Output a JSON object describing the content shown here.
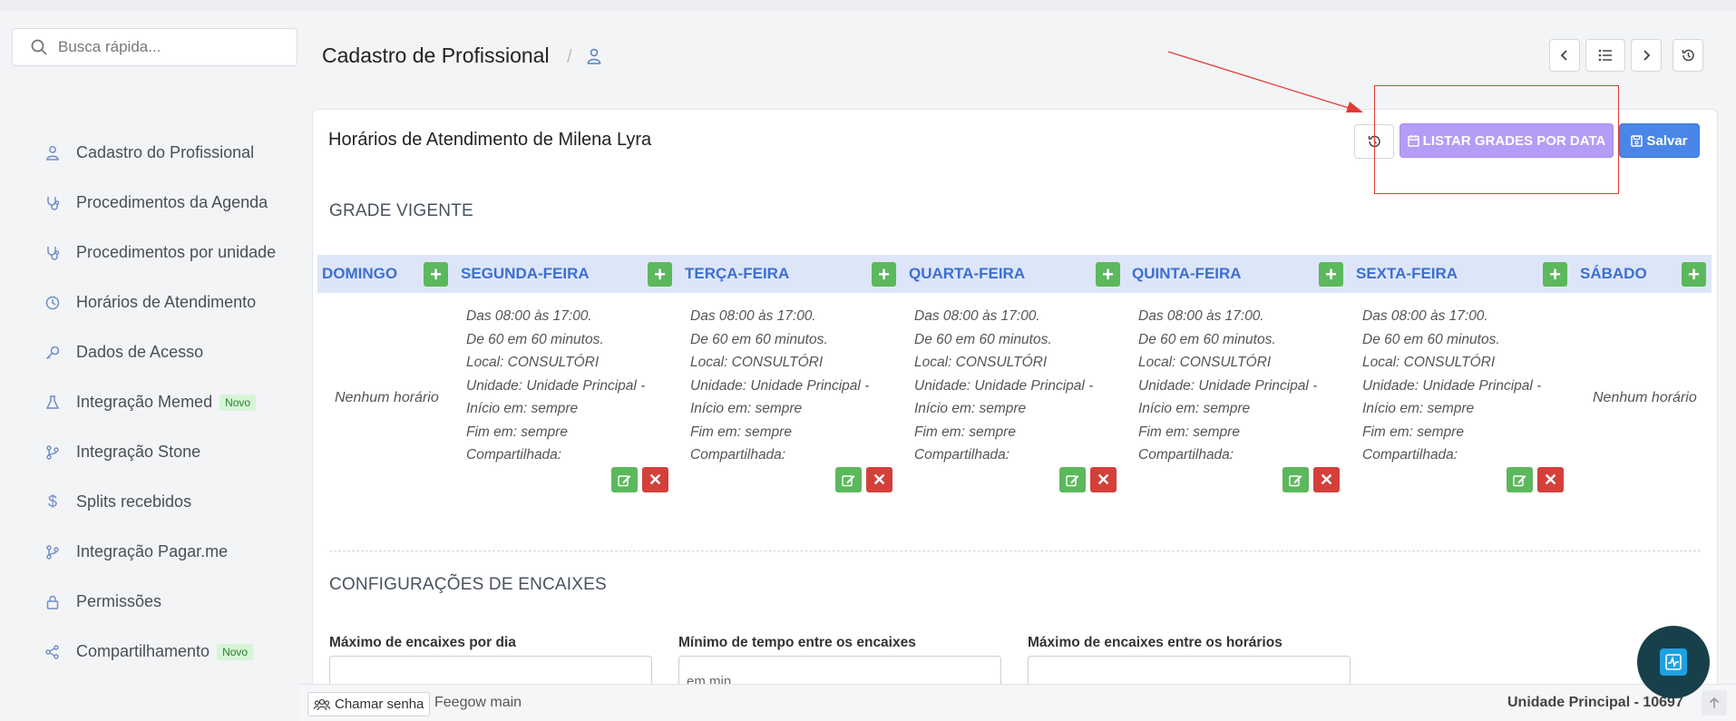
{
  "search": {
    "placeholder": "Busca rápida..."
  },
  "sidebar": {
    "items": [
      {
        "label": "Cadastro do Profissional",
        "icon": "user-doctor-icon"
      },
      {
        "label": "Procedimentos da Agenda",
        "icon": "stethoscope-icon"
      },
      {
        "label": "Procedimentos por unidade",
        "icon": "stethoscope-icon"
      },
      {
        "label": "Horários de Atendimento",
        "icon": "clock-icon"
      },
      {
        "label": "Dados de Acesso",
        "icon": "key-icon"
      },
      {
        "label": "Integração Memed",
        "icon": "flask-icon",
        "badge": "Novo"
      },
      {
        "label": "Integração Stone",
        "icon": "branch-icon"
      },
      {
        "label": "Splits recebidos",
        "icon": "dollar-icon"
      },
      {
        "label": "Integração Pagar.me",
        "icon": "branch-icon"
      },
      {
        "label": "Permissões",
        "icon": "lock-icon"
      },
      {
        "label": "Compartilhamento",
        "icon": "share-icon",
        "badge": "Novo"
      }
    ]
  },
  "header": {
    "title": "Cadastro de Profissional",
    "separator": "/"
  },
  "card": {
    "title": "Horários de Atendimento de Milena Lyra",
    "list_button": "LISTAR GRADES POR DATA",
    "save_button": "Salvar"
  },
  "grade": {
    "title": "GRADE VIGENTE",
    "days": [
      {
        "label": "DOMINGO",
        "empty": true,
        "empty_text": "Nenhum horário"
      },
      {
        "label": "SEGUNDA-FEIRA",
        "empty": false
      },
      {
        "label": "TERÇA-FEIRA",
        "empty": false
      },
      {
        "label": "QUARTA-FEIRA",
        "empty": false
      },
      {
        "label": "QUINTA-FEIRA",
        "empty": false
      },
      {
        "label": "SEXTA-FEIRA",
        "empty": false
      },
      {
        "label": "SÁBADO",
        "empty": true,
        "empty_text": "Nenhum horário"
      }
    ],
    "slot": {
      "hours": "Das 08:00 às 17:00.",
      "interval": "De 60 em 60 minutos.",
      "local": "Local: CONSULTÓRI",
      "unit": "Unidade: Unidade Principal -",
      "start": "Início em: sempre",
      "end": "Fim em: sempre",
      "shared": "Compartilhada:"
    },
    "add_symbol": "+",
    "delete_symbol": "✕"
  },
  "encaixes": {
    "title": "CONFIGURAÇÕES DE ENCAIXES",
    "fields": [
      {
        "label": "Máximo de encaixes por dia",
        "placeholder": ""
      },
      {
        "label": "Mínimo de tempo entre os encaixes",
        "placeholder": "em min"
      },
      {
        "label": "Máximo de encaixes entre os horários",
        "placeholder": ""
      }
    ]
  },
  "footer": {
    "call_button": "Chamar senha",
    "environment": "Feegow main",
    "unit": "Unidade Principal - 10697"
  },
  "colors": {
    "primary": "#4a86e8",
    "accent_purple": "#b59cf6",
    "success": "#5cb85c",
    "danger": "#d43f3a",
    "header_bg": "#dde6f9",
    "annotation": "#e53935"
  }
}
